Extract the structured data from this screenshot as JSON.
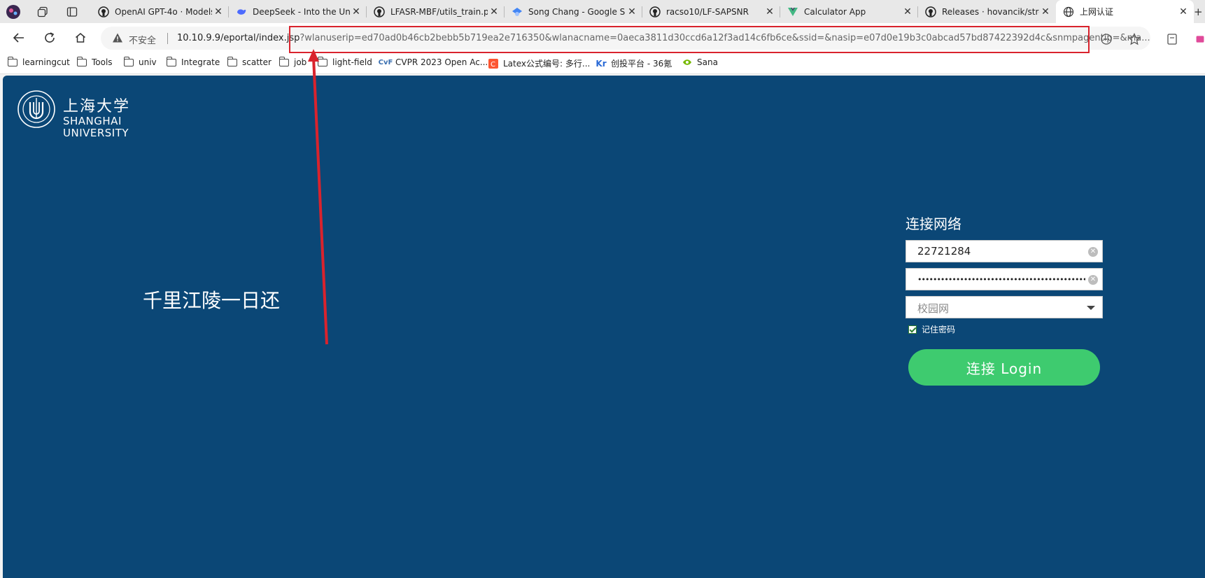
{
  "browser": {
    "tabs": [
      {
        "title": "OpenAI GPT-4o · Models",
        "icon": "github-icon"
      },
      {
        "title": "DeepSeek - Into the Unkno",
        "icon": "deepseek-icon"
      },
      {
        "title": "LFASR-MBF/utils_train.py",
        "icon": "github-icon"
      },
      {
        "title": "Song Chang - Google Scho",
        "icon": "scholar-icon"
      },
      {
        "title": "racso10/LF-SAPSNR",
        "icon": "github-icon"
      },
      {
        "title": "Calculator App",
        "icon": "vue-icon"
      },
      {
        "title": "Releases · hovancik/stretc",
        "icon": "github-icon"
      },
      {
        "title": "上网认证",
        "icon": "globe-icon"
      }
    ],
    "address": {
      "insecure_label": "不安全",
      "url_host": "10.10.9.9/eportal/index.jsp",
      "url_query": "?wlanuserip=ed70ad0b46cb2bebb5b719ea2e716350&wlanacname=0aeca3811d30ccd6a12f3ad14c6fb6ce&ssid=&nasip=e07d0e19b3c0abcad57bd87422392d4c&snmpagentip=&ma..."
    },
    "bookmarks": [
      {
        "label": "learningcut",
        "icon": "folder-icon"
      },
      {
        "label": "Tools",
        "icon": "folder-icon"
      },
      {
        "label": "univ",
        "icon": "folder-icon"
      },
      {
        "label": "Integrate",
        "icon": "folder-icon"
      },
      {
        "label": "scatter",
        "icon": "folder-icon"
      },
      {
        "label": "job",
        "icon": "folder-icon"
      },
      {
        "label": "light-field",
        "icon": "folder-icon"
      },
      {
        "label": "CVPR 2023 Open Ac...",
        "icon": "cvf-icon"
      },
      {
        "label": "Latex公式编号: 多行...",
        "icon": "csdn-icon"
      },
      {
        "label": "创投平台 - 36氪",
        "icon": "kr-icon"
      },
      {
        "label": "Sana",
        "icon": "nvidia-icon"
      }
    ]
  },
  "page": {
    "logo": {
      "cn": "上海大学",
      "en_line1": "SHANGHAI",
      "en_line2": "UNIVERSITY"
    },
    "slogan": "千里江陵一日还",
    "login": {
      "title": "连接网络",
      "username": "22721284",
      "password_mask": "•••••••••••••••••••••••••••••••••••••••••••••",
      "network_select": "校园网",
      "remember_label": "记住密码",
      "remember_checked": true,
      "button_label": "连接 Login"
    }
  },
  "colors": {
    "page_bg": "#0b4776",
    "login_button": "#3ecb6f",
    "annotation_red": "#d9232d"
  }
}
